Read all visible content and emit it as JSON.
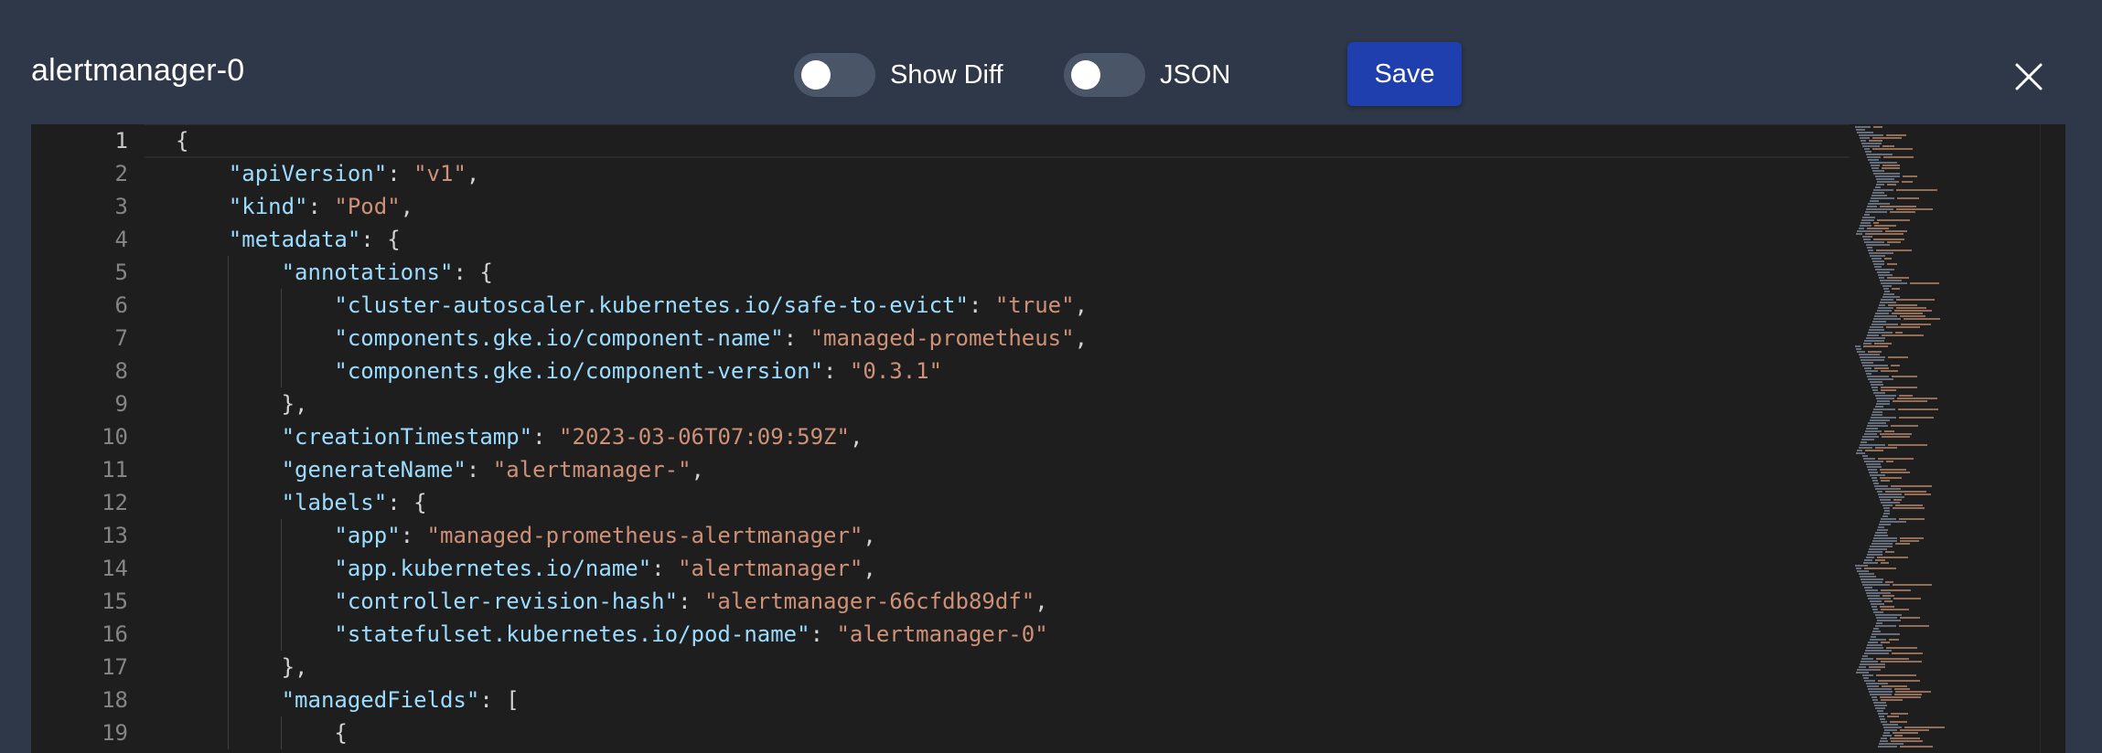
{
  "dialog": {
    "title": "alertmanager-0",
    "toggles": {
      "show_diff": {
        "label": "Show Diff",
        "on": false
      },
      "json": {
        "label": "JSON",
        "on": false
      }
    },
    "save_label": "Save",
    "close_icon": "close-icon"
  },
  "editor": {
    "language": "json",
    "active_line": 1,
    "lines": [
      {
        "n": "1",
        "indent": 0,
        "tokens": [
          {
            "t": "p",
            "v": "{"
          }
        ]
      },
      {
        "n": "2",
        "indent": 1,
        "tokens": [
          {
            "t": "k",
            "v": "\"apiVersion\""
          },
          {
            "t": "p",
            "v": ": "
          },
          {
            "t": "s",
            "v": "\"v1\""
          },
          {
            "t": "p",
            "v": ","
          }
        ]
      },
      {
        "n": "3",
        "indent": 1,
        "tokens": [
          {
            "t": "k",
            "v": "\"kind\""
          },
          {
            "t": "p",
            "v": ": "
          },
          {
            "t": "s",
            "v": "\"Pod\""
          },
          {
            "t": "p",
            "v": ","
          }
        ]
      },
      {
        "n": "4",
        "indent": 1,
        "tokens": [
          {
            "t": "k",
            "v": "\"metadata\""
          },
          {
            "t": "p",
            "v": ": {"
          }
        ]
      },
      {
        "n": "5",
        "indent": 2,
        "tokens": [
          {
            "t": "k",
            "v": "\"annotations\""
          },
          {
            "t": "p",
            "v": ": {"
          }
        ]
      },
      {
        "n": "6",
        "indent": 3,
        "tokens": [
          {
            "t": "k",
            "v": "\"cluster-autoscaler.kubernetes.io/safe-to-evict\""
          },
          {
            "t": "p",
            "v": ": "
          },
          {
            "t": "s",
            "v": "\"true\""
          },
          {
            "t": "p",
            "v": ","
          }
        ]
      },
      {
        "n": "7",
        "indent": 3,
        "tokens": [
          {
            "t": "k",
            "v": "\"components.gke.io/component-name\""
          },
          {
            "t": "p",
            "v": ": "
          },
          {
            "t": "s",
            "v": "\"managed-prometheus\""
          },
          {
            "t": "p",
            "v": ","
          }
        ]
      },
      {
        "n": "8",
        "indent": 3,
        "tokens": [
          {
            "t": "k",
            "v": "\"components.gke.io/component-version\""
          },
          {
            "t": "p",
            "v": ": "
          },
          {
            "t": "s",
            "v": "\"0.3.1\""
          }
        ]
      },
      {
        "n": "9",
        "indent": 2,
        "tokens": [
          {
            "t": "p",
            "v": "},"
          }
        ]
      },
      {
        "n": "10",
        "indent": 2,
        "tokens": [
          {
            "t": "k",
            "v": "\"creationTimestamp\""
          },
          {
            "t": "p",
            "v": ": "
          },
          {
            "t": "s",
            "v": "\"2023-03-06T07:09:59Z\""
          },
          {
            "t": "p",
            "v": ","
          }
        ]
      },
      {
        "n": "11",
        "indent": 2,
        "tokens": [
          {
            "t": "k",
            "v": "\"generateName\""
          },
          {
            "t": "p",
            "v": ": "
          },
          {
            "t": "s",
            "v": "\"alertmanager-\""
          },
          {
            "t": "p",
            "v": ","
          }
        ]
      },
      {
        "n": "12",
        "indent": 2,
        "tokens": [
          {
            "t": "k",
            "v": "\"labels\""
          },
          {
            "t": "p",
            "v": ": {"
          }
        ]
      },
      {
        "n": "13",
        "indent": 3,
        "tokens": [
          {
            "t": "k",
            "v": "\"app\""
          },
          {
            "t": "p",
            "v": ": "
          },
          {
            "t": "s",
            "v": "\"managed-prometheus-alertmanager\""
          },
          {
            "t": "p",
            "v": ","
          }
        ]
      },
      {
        "n": "14",
        "indent": 3,
        "tokens": [
          {
            "t": "k",
            "v": "\"app.kubernetes.io/name\""
          },
          {
            "t": "p",
            "v": ": "
          },
          {
            "t": "s",
            "v": "\"alertmanager\""
          },
          {
            "t": "p",
            "v": ","
          }
        ]
      },
      {
        "n": "15",
        "indent": 3,
        "tokens": [
          {
            "t": "k",
            "v": "\"controller-revision-hash\""
          },
          {
            "t": "p",
            "v": ": "
          },
          {
            "t": "s",
            "v": "\"alertmanager-66cfdb89df\""
          },
          {
            "t": "p",
            "v": ","
          }
        ]
      },
      {
        "n": "16",
        "indent": 3,
        "tokens": [
          {
            "t": "k",
            "v": "\"statefulset.kubernetes.io/pod-name\""
          },
          {
            "t": "p",
            "v": ": "
          },
          {
            "t": "s",
            "v": "\"alertmanager-0\""
          }
        ]
      },
      {
        "n": "17",
        "indent": 2,
        "tokens": [
          {
            "t": "p",
            "v": "},"
          }
        ]
      },
      {
        "n": "18",
        "indent": 2,
        "tokens": [
          {
            "t": "k",
            "v": "\"managedFields\""
          },
          {
            "t": "p",
            "v": ": ["
          }
        ]
      },
      {
        "n": "19",
        "indent": 3,
        "tokens": [
          {
            "t": "p",
            "v": "{"
          }
        ]
      }
    ]
  },
  "colors": {
    "header_bg": "#2f3848",
    "editor_bg": "#1e1e1e",
    "key": "#9cdcfe",
    "string": "#ce9178",
    "punct": "#d4d4d4",
    "line_number": "#858585",
    "save_button": "#1f3fae",
    "toggle_off": "#4a5568"
  }
}
